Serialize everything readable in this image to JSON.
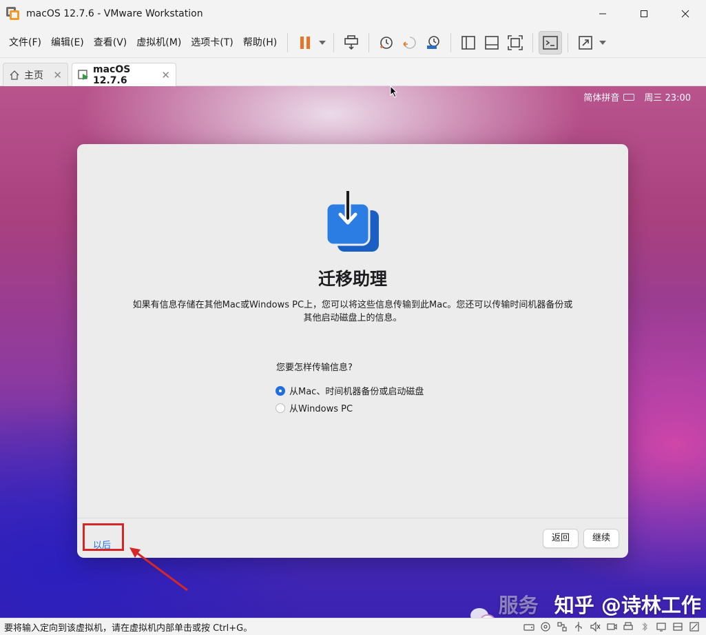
{
  "window": {
    "title": "macOS 12.7.6 - VMware Workstation"
  },
  "menu": [
    {
      "label": "文件(F)"
    },
    {
      "label": "编辑(E)"
    },
    {
      "label": "查看(V)"
    },
    {
      "label": "虚拟机(M)"
    },
    {
      "label": "选项卡(T)"
    },
    {
      "label": "帮助(H)"
    }
  ],
  "toolbar": {
    "icons": [
      "pause-icon",
      "send-keys-icon",
      "snapshot-icon",
      "revert-snapshot-icon",
      "snapshot-manager-icon",
      "library-view-icon",
      "thumbnail-view-icon",
      "fit-guest-icon",
      "console-view-icon",
      "fullscreen-icon"
    ],
    "accent_pause": "#e8742a"
  },
  "tabs": [
    {
      "label": "主页"
    },
    {
      "label": "macOS 12.7.6"
    }
  ],
  "mac_menubar": {
    "input_method": "简体拼音",
    "clock": "周三 23:00"
  },
  "dialog": {
    "title": "迁移助理",
    "description": "如果有信息存储在其他Mac或Windows PC上，您可以将这些信息传输到此Mac。您还可以传输时间机器备份或其他启动磁盘上的信息。",
    "question": "您要怎样传输信息?",
    "options": [
      {
        "label": "从Mac、时间机器备份或启动磁盘",
        "selected": true
      },
      {
        "label": "从Windows PC",
        "selected": false
      }
    ],
    "later_label": "以后",
    "back_label": "返回",
    "continue_label": "继续",
    "accent": "#1f6fe0"
  },
  "watermark": {
    "faded": "服务号",
    "text": "知乎 @诗林工作室"
  },
  "statusbar": {
    "text": "要将输入定向到该虚拟机，请在虚拟机内部单击或按 Ctrl+G。"
  }
}
